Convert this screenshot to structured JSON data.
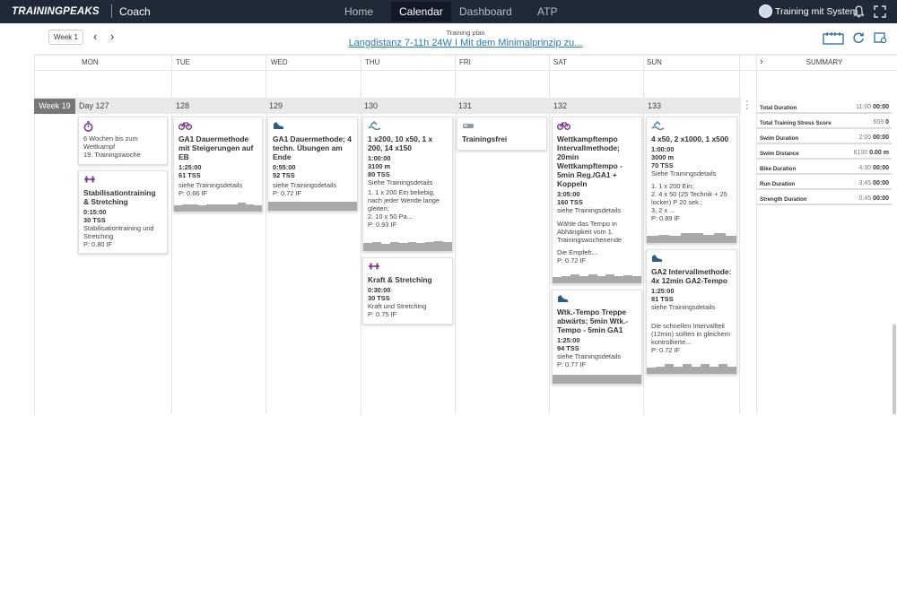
{
  "app": {
    "logo": "TRAININGPEAKS",
    "role": "Coach",
    "nav": [
      "Home",
      "Calendar",
      "Dashboard",
      "ATP"
    ],
    "user": "Training mit System"
  },
  "toolbar": {
    "week_button": "Week 1",
    "prev": "‹",
    "next": "›",
    "plan_label": "Training plan",
    "plan_name": "Langdistanz 7-11h 24W I Mit dem Minimalprinzip zu..."
  },
  "days": [
    "MON",
    "TUE",
    "WED",
    "THU",
    "FRI",
    "SAT",
    "SUN"
  ],
  "summary_label": "SUMMARY",
  "week": {
    "label": "Week 19",
    "day_numbers": [
      "Day 127",
      "128",
      "129",
      "130",
      "131",
      "132",
      "133"
    ]
  },
  "cards": {
    "mon1": {
      "icon": "stopwatch-icon",
      "lines": [
        "6 Wochen bis zum Wettkampf",
        "19. Trainingswoche"
      ]
    },
    "mon2": {
      "icon": "dumbbell-icon",
      "title": "Stabilisationtraining & Stretching",
      "duration": "0:15:00",
      "tss": "30 TSS",
      "desc": "Stabilisationtraining und Stretching",
      "metric": "P: 0.80 IF"
    },
    "tue1": {
      "icon": "bike-icon",
      "title": "GA1 Dauermethode mit Steigerungen auf EB",
      "duration": "1:25:00",
      "tss": "61 TSS",
      "desc": "siehe Trainingsdetails",
      "metric": "P: 0.66 IF"
    },
    "wed1": {
      "icon": "shoe-icon",
      "title": "GA1 Dauermethode; 4 techn. Übungen am Ende",
      "duration": "0:55:00",
      "tss": "52 TSS",
      "desc": "siehe Trainingsdetails",
      "metric": "P: 0.72 IF"
    },
    "thu1": {
      "icon": "swim-icon",
      "title": "1 x200, 10 x50, 1 x 200, 14 x150",
      "duration": "1:00:00",
      "dist": "3100 m",
      "tss": "80 TSS",
      "desc": "Siehe Trainingsdetails",
      "desc2": "1. 1 x 200 Ein beliebig, nach jeder Wende lange gleiten;",
      "desc3": "2. 10 x 50 Pa...",
      "metric": "P: 0.93 IF"
    },
    "thu2": {
      "icon": "dumbbell-icon",
      "title": "Kraft & Stretching",
      "duration": "0:30:00",
      "tss": "30 TSS",
      "desc": "Kraft und Stretching",
      "metric": "P: 0.75 IF"
    },
    "fri1": {
      "icon": "bed-icon",
      "title": "Trainingsfrei"
    },
    "sat1": {
      "icon": "bike-icon",
      "title": "Wettkampftempo Intervallmethode; 20min Wettkampftempo - 5min Reg./GA1 + Koppeln",
      "duration": "3:05:00",
      "tss": "160 TSS",
      "desc": "siehe Trainingsdetails",
      "desc2": "Wähle das Tempo in Abhängikeit vom 1. Trainingswochenende",
      "desc3": "Die Empfeh...",
      "metric": "P: 0.72 IF"
    },
    "sat2": {
      "icon": "shoe-icon",
      "title": "Wtk.-Tempo Treppe abwärts; 5min Wtk.-Tempo - 5min GA1",
      "duration": "1:25:00",
      "tss": "94 TSS",
      "desc": "siehe Trainingsdetails",
      "metric": "P: 0.77 IF"
    },
    "sun1": {
      "icon": "swim-icon",
      "title": "4 x50, 2 x1000, 1 x500",
      "duration": "1:00:00",
      "dist": "3000 m",
      "tss": "70 TSS",
      "desc": "Siehe Trainingsdetails",
      "desc2": "1. 1 x 200 Ein;",
      "desc3": "2. 4 x 50 (25 Technik + 25 locker) P 20 sek.;",
      "desc4": "3. 2 x ...",
      "metric": "P: 0.89 IF"
    },
    "sun2": {
      "icon": "shoe-icon",
      "title": "GA2 Intervallmethode: 4x 12min GA2-Tempo",
      "duration": "1:25:00",
      "tss": "81 TSS",
      "desc": "siehe Trainingsdetails",
      "desc2": "Die schnellen Intervallteil (12min) sollten in gleichem kontrollierte...",
      "metric": "P: 0.72 IF"
    }
  },
  "summary": [
    {
      "label": "Total Duration",
      "planned": "11:00",
      "actual": "00:00"
    },
    {
      "label": "Total Training Stress Score",
      "planned": "659",
      "actual": "0"
    },
    {
      "label": "Swim Duration",
      "planned": "2:00",
      "actual": "00:00"
    },
    {
      "label": "Swim Distance",
      "planned": "6100",
      "actual": "0.00 m"
    },
    {
      "label": "Bike Duration",
      "planned": "4:30",
      "actual": "00:00"
    },
    {
      "label": "Run Duration",
      "planned": "3:45",
      "actual": "00:00"
    },
    {
      "label": "Strength Duration",
      "planned": "0:45",
      "actual": "00:00"
    }
  ],
  "colors": {
    "topbar": "#1f2937",
    "link": "#2a7ab8",
    "bike": "#7a3a8c",
    "run": "#2f5c86",
    "swim": "#5a86b8",
    "strength": "#7a3a8c"
  }
}
